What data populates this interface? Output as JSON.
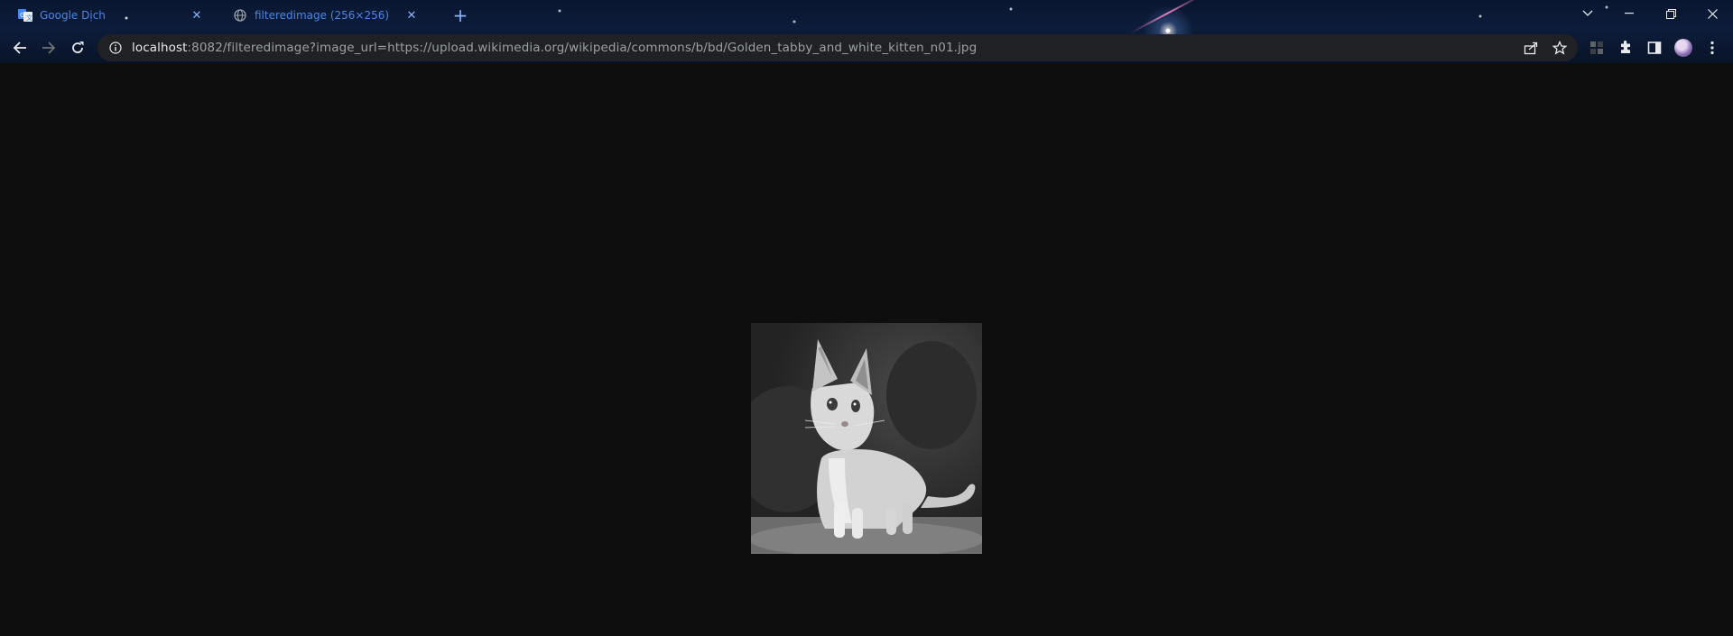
{
  "tabs": [
    {
      "title": "Google Dịch",
      "favicon": "google-translate-icon"
    },
    {
      "title": "filteredimage (256×256)",
      "favicon": "globe-icon"
    }
  ],
  "omnibox": {
    "host": "localhost",
    "rest": ":8082/filteredimage?image_url=https://upload.wikimedia.org/wikipedia/commons/b/bd/Golden_tabby_and_white_kitten_n01.jpg"
  },
  "image": {
    "description_icon": "kitten-grayscale-image",
    "filter": "grayscale"
  },
  "colors": {
    "accent": "#8ab4f8",
    "tab_text": "#4a86e8",
    "page_bg": "#0e0e0e",
    "omnibox_bg": "#202124"
  }
}
